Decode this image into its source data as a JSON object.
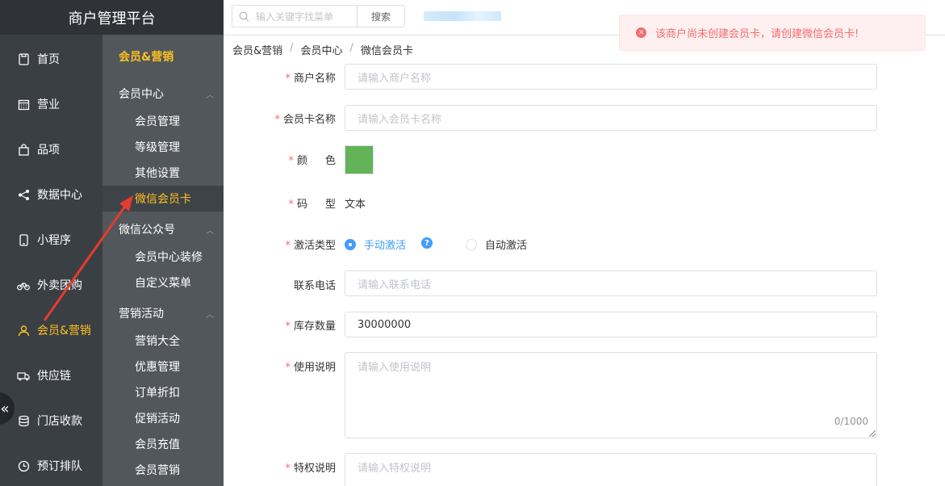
{
  "app": {
    "title": "商户管理平台"
  },
  "nav_primary": [
    {
      "label": "首页",
      "icon": "phone-icon"
    },
    {
      "label": "营业",
      "icon": "calendar-icon"
    },
    {
      "label": "品项",
      "icon": "bag-icon"
    },
    {
      "label": "数据中心",
      "icon": "share-icon"
    },
    {
      "label": "小程序",
      "icon": "mobile-icon"
    },
    {
      "label": "外卖团购",
      "icon": "bike-icon"
    },
    {
      "label": "会员&营销",
      "icon": "user-icon",
      "active": true
    },
    {
      "label": "供应链",
      "icon": "truck-icon"
    },
    {
      "label": "门店收款",
      "icon": "coins-icon"
    },
    {
      "label": "预订排队",
      "icon": "clock-icon"
    }
  ],
  "nav_collapse_icon": "«",
  "nav_secondary": {
    "title": "会员&营销",
    "groups": [
      {
        "label": "会员中心",
        "items": [
          "会员管理",
          "等级管理",
          "其他设置",
          "微信会员卡"
        ]
      },
      {
        "label": "微信公众号",
        "items": [
          "会员中心装修",
          "自定义菜单"
        ]
      },
      {
        "label": "营销活动",
        "items": [
          "营销大全",
          "优惠管理",
          "订单折扣",
          "促销活动",
          "会员充值",
          "会员营销"
        ]
      }
    ],
    "active_item": "微信会员卡"
  },
  "topbar": {
    "search_placeholder": "输入关键字找菜单",
    "search_button": "搜索"
  },
  "toast": {
    "message": "该商户尚未创建会员卡，请创建微信会员卡!"
  },
  "breadcrumb": [
    "会员&营销",
    "会员中心",
    "微信会员卡"
  ],
  "form": {
    "merchant_name": {
      "label": "商户名称",
      "placeholder": "请输入商户名称"
    },
    "card_name": {
      "label": "会员卡名称",
      "placeholder": "请输入会员卡名称"
    },
    "color": {
      "label": "颜色",
      "value": "#63b359"
    },
    "code_type": {
      "label": "码型",
      "value": "文本"
    },
    "activation": {
      "label": "激活类型",
      "options": [
        "手动激活",
        "自动激活"
      ],
      "selected": "手动激活"
    },
    "phone": {
      "label": "联系电话",
      "placeholder": "请输入联系电话"
    },
    "stock": {
      "label": "库存数量",
      "value": "30000000"
    },
    "usage": {
      "label": "使用说明",
      "placeholder": "请输入使用说明",
      "counter": "0/1000"
    },
    "privilege": {
      "label": "特权说明",
      "placeholder": "请输入特权说明"
    }
  },
  "colors": {
    "accent": "#ffc11e",
    "primary": "#409eff",
    "danger": "#f56c6c",
    "swatch": "#63b359"
  }
}
